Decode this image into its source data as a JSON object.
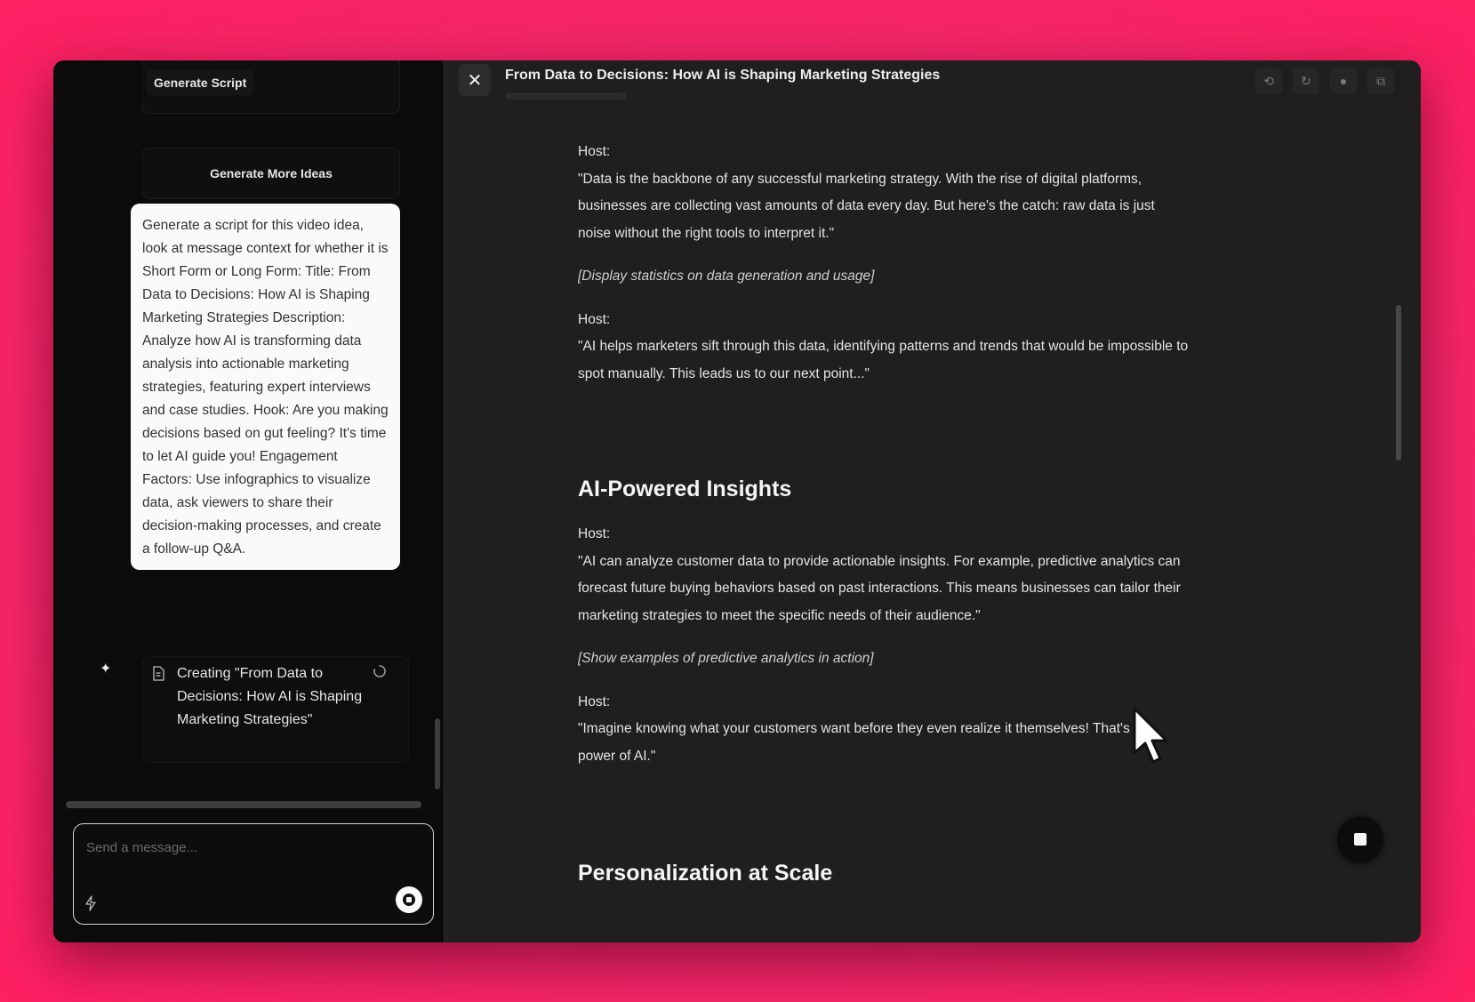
{
  "chat": {
    "generate_script_label": "Generate Script",
    "generate_more_label": "Generate More Ideas",
    "user_message": "Generate a script for this video idea, look at message context for whether it is Short Form or Long Form: Title: From Data to Decisions: How AI is Shaping Marketing Strategies Description: Analyze how AI is transforming data analysis into actionable marketing strategies, featuring expert interviews and case studies. Hook: Are you making decisions based on gut feeling? It's time to let AI guide you! Engagement Factors: Use infographics to visualize data, ask viewers to share their decision-making processes, and create a follow-up Q&A.",
    "ai_status": "Creating \"From Data to Decisions: How AI is Shaping Marketing Strategies\"",
    "composer_placeholder": "Send a message..."
  },
  "document": {
    "title": "From Data to Decisions: How AI is Shaping Marketing Strategies",
    "blocks": [
      {
        "host_label": "Host:",
        "line": "\"Data is the backbone of any successful marketing strategy. With the rise of digital platforms, businesses are collecting vast amounts of data every day. But here's the catch: raw data is just noise without the right tools to interpret it.\""
      },
      {
        "stage": "[Display statistics on data generation and usage]"
      },
      {
        "host_label": "Host:",
        "line": "\"AI helps marketers sift through this data, identifying patterns and trends that would be impossible to spot manually. This leads us to our next point...\""
      }
    ],
    "section_1_heading": "AI-Powered Insights",
    "section_1": [
      {
        "host_label": "Host:",
        "line": "\"AI can analyze customer data to provide actionable insights. For example, predictive analytics can forecast future buying behaviors based on past interactions. This means businesses can tailor their marketing strategies to meet the specific needs of their audience.\""
      },
      {
        "stage": "[Show examples of predictive analytics in action]"
      },
      {
        "host_label": "Host:",
        "line": "\"Imagine knowing what your customers want before they even realize it themselves! That's the power of AI.\""
      }
    ],
    "section_2_heading": "Personalization at Scale"
  },
  "icons": {
    "close": "close-icon",
    "sparkle": "sparkle-icon",
    "doc": "document-icon",
    "spinner": "spinner-icon",
    "bolt": "bolt-icon",
    "history": "history-icon",
    "refresh": "refresh-icon",
    "record": "record-icon",
    "copy": "copy-icon"
  },
  "colors": {
    "background_accent": "#f0286a",
    "window": "#1f1f1f",
    "chat_panel": "#0b0b0b",
    "user_bubble": "#fafafa"
  }
}
